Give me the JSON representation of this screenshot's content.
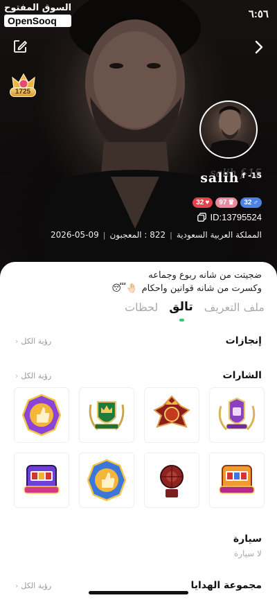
{
  "watermark": {
    "arabic": "السوق المفتوح",
    "latin": "OpenSooq"
  },
  "status_bar": {
    "time": "٦:٥٦"
  },
  "profile": {
    "level_count": "1725",
    "name_shadow": "salih f-15",
    "username": "salih",
    "username_suffix": "f -15",
    "stats": [
      {
        "value": "32",
        "icon": "heart-icon",
        "color": "#e0444d"
      },
      {
        "value": "97",
        "icon": "crown-icon",
        "color": "#e9899f"
      },
      {
        "value": "32",
        "icon": "male-icon",
        "color": "#4c83e6"
      }
    ],
    "user_id": "ID:13795524",
    "country": "المملكة العربية السعودية",
    "fans_label": "822 : المعجبون",
    "join_date": "2026-05-09",
    "meta_sep": "|"
  },
  "bio": {
    "line1": "ضجيتت من شانه ربوع وجماعه",
    "line2": "وكسرت من شانه قوانين واحكام",
    "emoji": "🤚🏻😴"
  },
  "tabs": [
    {
      "label": "ملف التعريف",
      "active": false
    },
    {
      "label": "تالق",
      "active": true
    },
    {
      "label": "لحظات",
      "active": false
    }
  ],
  "sections": {
    "achievements": {
      "title": "إنجازات",
      "see_all": "رؤية الكل"
    },
    "badges": {
      "title": "الشارات",
      "see_all": "رؤية الكل",
      "items": [
        {
          "icon": "purple-shield-badge-icon"
        },
        {
          "icon": "red-crown-emblem-badge-icon"
        },
        {
          "icon": "green-crown-shield-badge-icon"
        },
        {
          "icon": "thumbs-up-purple-badge-icon"
        },
        {
          "icon": "jackpot-slot-badge-icon"
        },
        {
          "icon": "roulette-wheel-badge-icon"
        },
        {
          "icon": "thumbs-up-blue-badge-icon"
        },
        {
          "icon": "jackpot-slot-purple-badge-icon"
        }
      ]
    },
    "car": {
      "title": "سيارة",
      "empty": "لا سيارة"
    },
    "gifts": {
      "title": "مجموعة الهدايا",
      "see_all": "رؤية الكل"
    }
  },
  "colors": {
    "accent_green": "#39c86a",
    "card_bg": "#ffffff",
    "hero_bg": "#121010"
  }
}
